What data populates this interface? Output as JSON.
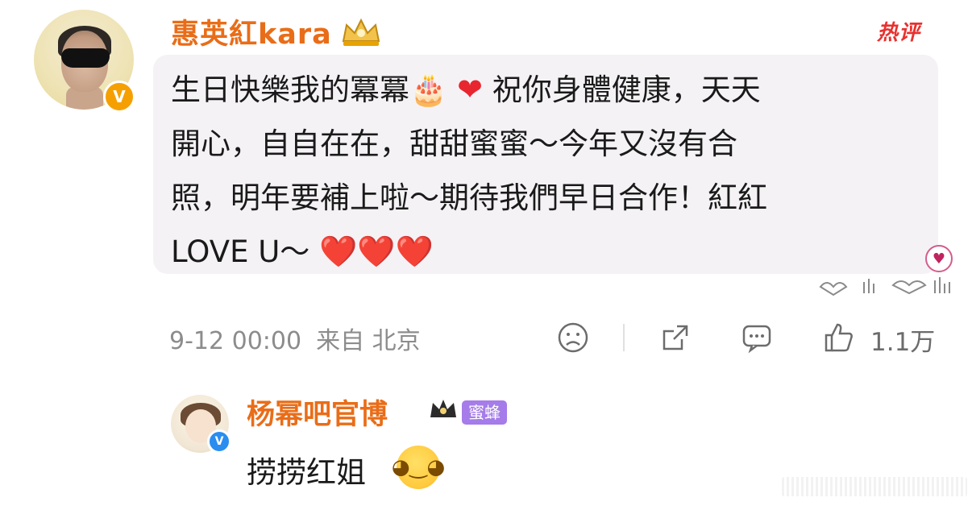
{
  "comment": {
    "username": "惠英紅kara",
    "hot_label": "热评",
    "text": {
      "line1_pre": "生日快樂我的冪冪",
      "cake_emoji": "🎂",
      "heart": "❤",
      "line1_post": "祝你身體健康，天天",
      "line2": "開心，自自在在，甜甜蜜蜜～今年又沒有合",
      "line3": "照，明年要補上啦～期待我們早日合作！紅紅",
      "line4": "LOVE U～",
      "hearts": "❤️❤️❤️"
    },
    "timestamp": "9-12 00:00",
    "source": "来自 北京",
    "like_count": "1.1万",
    "verified_badge": "V",
    "icons": [
      "sad-face-icon",
      "share-icon",
      "comment-icon",
      "thumbs-up-icon",
      "heart-badge-icon",
      "crown-icon"
    ]
  },
  "reply": {
    "username": "杨幂吧官博",
    "fan_badge": "蜜蜂",
    "text": "捞捞红姐",
    "verified_badge": "V"
  }
}
